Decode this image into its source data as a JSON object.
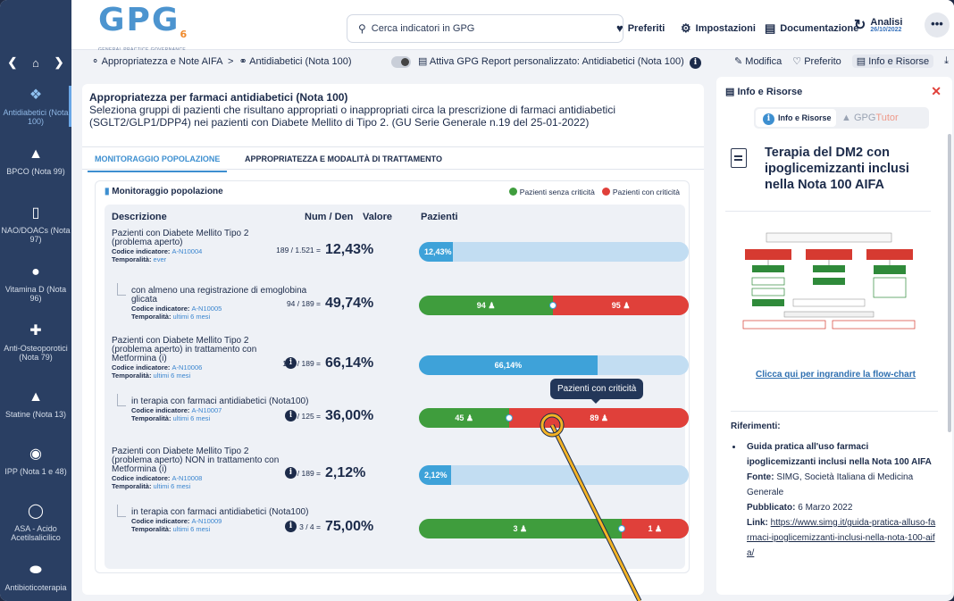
{
  "header": {
    "logo": "GPG",
    "logo_sub": "6",
    "logo_tagline": "GENERAL PRACTICE GOVERNANCE",
    "search_placeholder": "Cerca indicatori in GPG",
    "preferiti": "Preferiti",
    "impostazioni": "Impostazioni",
    "documentazione": "Documentazione",
    "analisi": "Analisi",
    "analisi_date": "26/10/2022",
    "more": "•••"
  },
  "breadcrumb": {
    "item1": "Appropriatezza e Note AIFA",
    "sep": ">",
    "item2": "Antidiabetici (Nota 100)",
    "gpg_report": "Attiva GPG Report personalizzato: Antidiabetici (Nota 100)",
    "modifica": "Modifica",
    "preferito": "Preferito",
    "info_risorse": "Info e Risorse"
  },
  "sidebar": {
    "items": [
      {
        "label": "Antidiabetici (Nota 100)",
        "icon": "pill-icon"
      },
      {
        "label": "BPCO (Nota 99)",
        "icon": "inhaler-icon"
      },
      {
        "label": "NAO/DOACs (Nota 97)",
        "icon": "blood-drop-icon"
      },
      {
        "label": "Vitamina D (Nota 96)",
        "icon": "capsule-icon"
      },
      {
        "label": "Anti-Osteoporotici (Nota 79)",
        "icon": "medkit-icon"
      },
      {
        "label": "Statine (Nota 13)",
        "icon": "drops-icon"
      },
      {
        "label": "IPP (Nota 1 e 48)",
        "icon": "pills-icon"
      },
      {
        "label": "ASA - Acido Acetilsalicilico",
        "icon": "tablet-icon"
      },
      {
        "label": "Antibioticoterapia",
        "icon": "capsule-icon"
      }
    ]
  },
  "main": {
    "title": "Appropriatezza per farmaci antidiabetici (Nota 100)",
    "description": "Seleziona gruppi di pazienti che risultano appropriati o inappropriati circa la prescrizione di farmaci antidiabetici (SGLT2/GLP1/DPP4) nei pazienti con Diabete Mellito di Tipo 2. (GU Serie Generale n.19 del 25-01-2022)",
    "tabs": [
      "MONITORAGGIO POPOLAZIONE",
      "APPROPRIATEZZA E MODALITÀ DI TRATTAMENTO"
    ],
    "card_title": "Monitoraggio popolazione",
    "legend_ok": "Pazienti senza criticità",
    "legend_crit": "Pazienti con criticità",
    "columns": [
      "Descrizione",
      "Num / Den",
      "Valore",
      "Pazienti"
    ],
    "rows": [
      {
        "desc": "Pazienti con Diabete Mellito Tipo 2 (problema aperto)",
        "code_label": "Codice indicatore:",
        "code": "A-N10004",
        "temp_label": "Temporalità:",
        "temp": "ever",
        "numden": "189 / 1.521 =",
        "value": "12,43%",
        "bar_label": "12,43%",
        "pct": 12.43
      },
      {
        "desc": "con almeno una registrazione di emoglobina glicata",
        "code_label": "Codice indicatore:",
        "code": "A-N10005",
        "temp_label": "Temporalità:",
        "temp": "ultimi 6 mesi",
        "numden": "94 / 189 =",
        "value": "49,74%",
        "ok": "94",
        "crit": "95",
        "pct": 49.74
      },
      {
        "desc": "Pazienti con Diabete Mellito Tipo 2 (problema aperto) in trattamento con Metformina (i)",
        "code_label": "Codice indicatore:",
        "code": "A-N10006",
        "temp_label": "Temporalità:",
        "temp": "ultimi 6 mesi",
        "numden": "125 / 189 =",
        "value": "66,14%",
        "bar_label": "66,14%",
        "pct": 66.14
      },
      {
        "desc": "in terapia con farmaci antidiabetici (Nota100)",
        "code_label": "Codice indicatore:",
        "code": "A-N10007",
        "temp_label": "Temporalità:",
        "temp": "ultimi 6 mesi",
        "numden": "45 / 125 =",
        "value": "36,00%",
        "ok": "45",
        "crit": "89",
        "pct": 36.0
      },
      {
        "desc": "Pazienti con Diabete Mellito Tipo 2 (problema aperto) NON in trattamento con Metformina (i)",
        "code_label": "Codice indicatore:",
        "code": "A-N10008",
        "temp_label": "Temporalità:",
        "temp": "ultimi 6 mesi",
        "numden": "4 / 189 =",
        "value": "2,12%",
        "bar_label": "2,12%",
        "pct": 2.12
      },
      {
        "desc": "in terapia con farmaci antidiabetici (Nota100)",
        "code_label": "Codice indicatore:",
        "code": "A-N10009",
        "temp_label": "Temporalità:",
        "temp": "ultimi 6 mesi",
        "numden": "3 / 4 =",
        "value": "75,00%",
        "ok": "3",
        "crit": "1",
        "pct": 75.0
      }
    ],
    "tooltip": "Pazienti con criticità"
  },
  "info_panel": {
    "title": "Info e Risorse",
    "tab1": "Info e Risorse",
    "tab2_a": "GPG",
    "tab2_b": "Tutor",
    "doc_title": "Terapia del DM2 con ipoglicemizzanti inclusi nella Nota 100 AIFA",
    "flow_link": "Clicca qui per ingrandire la flow-chart",
    "refs_title": "Riferimenti:",
    "ref_title": "Guida pratica all'uso farmaci ipoglicemizzanti inclusi nella Nota 100 AIFA",
    "fonte_label": "Fonte:",
    "fonte": "SIMG, Società Italiana di Medicina Generale",
    "pubblicato_label": "Pubblicato:",
    "pubblicato": "6 Marzo 2022",
    "link_label": "Link:",
    "link": "https://www.simg.it/guida-pratica-alluso-farmaci-ipoglicemizzanti-inclusi-nella-nota-100-aifa/"
  },
  "colors": {
    "accent": "#3ea2d9",
    "ok": "#3f9d3d",
    "crit": "#e0403a",
    "nav": "#2a3f63"
  }
}
